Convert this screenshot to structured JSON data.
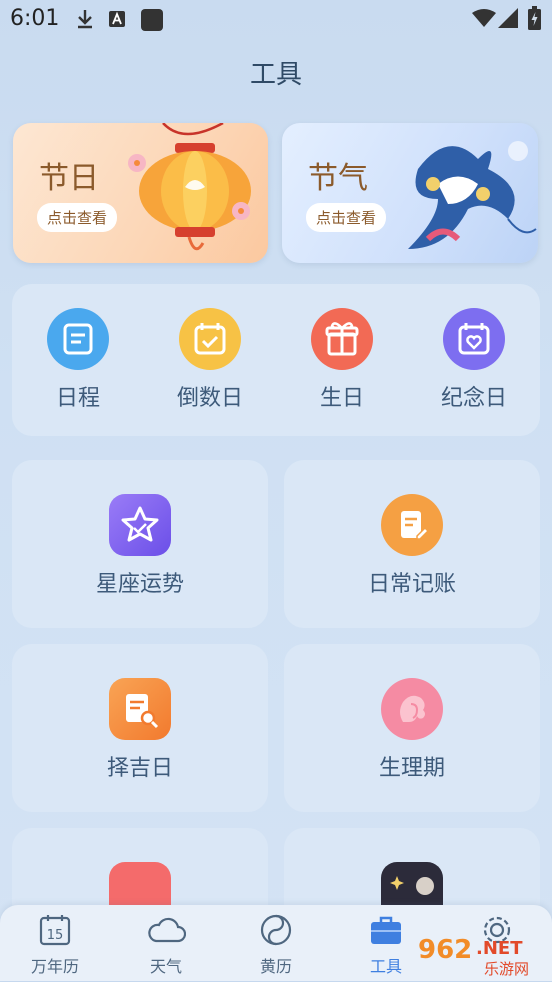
{
  "status_bar": {
    "time": "6:01"
  },
  "header": {
    "title": "工具"
  },
  "banners": [
    {
      "title": "节日",
      "button": "点击查看"
    },
    {
      "title": "节气",
      "button": "点击查看"
    }
  ],
  "quick_tools": [
    {
      "label": "日程",
      "icon": "schedule-icon",
      "color": "#4aa8ee"
    },
    {
      "label": "倒数日",
      "icon": "calendar-check-icon",
      "color": "#f7c245"
    },
    {
      "label": "生日",
      "icon": "gift-icon",
      "color": "#f26a55"
    },
    {
      "label": "纪念日",
      "icon": "calendar-heart-icon",
      "color": "#7d6ef0"
    }
  ],
  "features": [
    {
      "label": "星座运势",
      "icon": "star-icon",
      "color": "#7b5ff0"
    },
    {
      "label": "日常记账",
      "icon": "note-edit-icon",
      "color": "#f5a043"
    },
    {
      "label": "择吉日",
      "icon": "doc-search-icon",
      "color": "#f58a3c"
    },
    {
      "label": "生理期",
      "icon": "woman-profile-icon",
      "color": "#f58ba3"
    }
  ],
  "tabs": [
    {
      "label": "万年历",
      "icon": "calendar-15-icon",
      "day": "15",
      "active": false
    },
    {
      "label": "天气",
      "icon": "cloud-icon",
      "active": false
    },
    {
      "label": "黄历",
      "icon": "yinyang-icon",
      "active": false
    },
    {
      "label": "工具",
      "icon": "toolbox-icon",
      "active": true
    },
    {
      "label": "",
      "icon": "gear-icon",
      "active": false
    }
  ],
  "watermark": {
    "number": "962",
    "suffix": ".NET",
    "text": "乐游网"
  },
  "colors": {
    "accent": "#3f7fe0",
    "background": "#cfe0f3",
    "card": "#dae7f6"
  }
}
